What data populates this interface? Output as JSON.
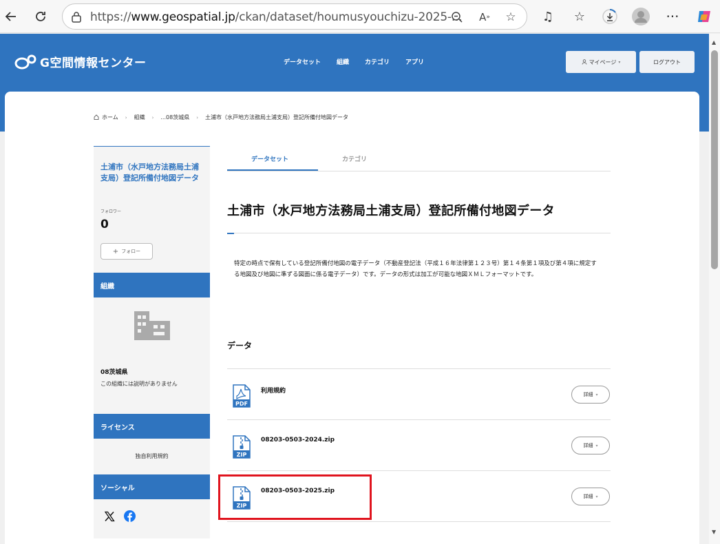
{
  "browser": {
    "url_prefix": "https://",
    "url_domain": "www.geospatial.jp",
    "url_path": "/ckan/dataset/houmusyouchizu-2025-..."
  },
  "header": {
    "logo_text": "G空間情報センター",
    "nav": [
      "データセット",
      "組織",
      "カテゴリ",
      "アプリ"
    ],
    "mypage_label": "マイページ",
    "logout_label": "ログアウト"
  },
  "breadcrumb": [
    "ホーム",
    "組織",
    "...08茨城県",
    "土浦市（水戸地方法務局土浦支局）登記所備付地図データ"
  ],
  "sidebar": {
    "title": "土浦市（水戸地方法務局土浦支局）登記所備付地図データ",
    "followers_label": "フォロワー",
    "followers_count": "0",
    "follow_button": "フォロー",
    "org_heading": "組織",
    "org_name": "08茨城県",
    "org_description": "この組織には説明がありません",
    "license_heading": "ライセンス",
    "license_text": "独自利用規約",
    "social_heading": "ソーシャル"
  },
  "main": {
    "tabs": [
      "データセット",
      "カテゴリ"
    ],
    "title": "土浦市（水戸地方法務局土浦支局）登記所備付地図データ",
    "description": "特定の時点で保有している登記所備付地図の電子データ（不動産登記法（平成１６年法律第１２３号）第１４条第１項及び第４項に規定する地図及び地図に準ずる図面に係る電子データ）です。データの形式は加工が可能な地図ＸＭＬフォーマットです。",
    "data_heading": "データ",
    "detail_label": "詳細",
    "resources": [
      {
        "name": "利用規約",
        "format": "PDF"
      },
      {
        "name": "08203-0503-2024.zip",
        "format": "ZIP"
      },
      {
        "name": "08203-0503-2025.zip",
        "format": "ZIP"
      }
    ]
  },
  "colors": {
    "brand": "#2f74bf",
    "highlight": "#e0141e"
  }
}
